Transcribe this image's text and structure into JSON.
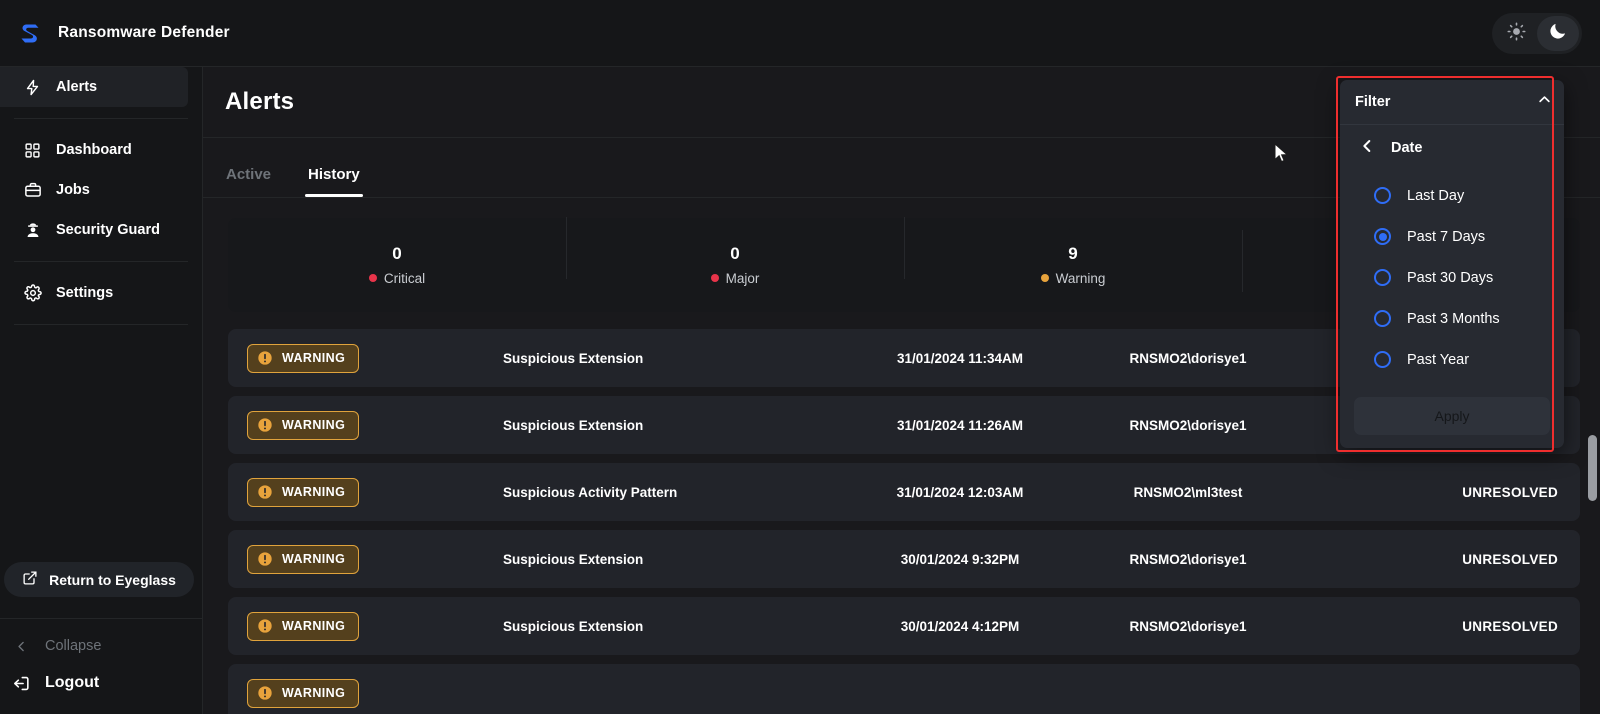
{
  "app": {
    "brand_title": "Ransomware Defender",
    "logo_icon": "shield-s-logo",
    "accent_color": "#2f6df6"
  },
  "theme_toggle": {
    "light_icon": "sun-icon",
    "dark_icon": "moon-icon",
    "active": "dark"
  },
  "sidebar": {
    "primary": [
      {
        "label": "Alerts",
        "icon": "lightning-bolt-icon",
        "active": true
      }
    ],
    "secondary": [
      {
        "label": "Dashboard",
        "icon": "grid-icon",
        "active": false
      },
      {
        "label": "Jobs",
        "icon": "briefcase-icon",
        "active": false
      },
      {
        "label": "Security Guard",
        "icon": "security-guard-icon",
        "active": false
      }
    ],
    "tertiary": [
      {
        "label": "Settings",
        "icon": "gear-icon",
        "active": false
      }
    ],
    "return_button": {
      "label": "Return to Eyeglass",
      "icon": "external-link-icon"
    },
    "collapse": {
      "label": "Collapse",
      "icon": "chevron-left-icon"
    },
    "logout": {
      "label": "Logout",
      "icon": "logout-icon"
    }
  },
  "main": {
    "page_title": "Alerts",
    "tabs": [
      {
        "label": "Active",
        "active": false
      },
      {
        "label": "History",
        "active": true
      }
    ],
    "stats": [
      {
        "value": "0",
        "label": "Critical",
        "color": "#e8344a"
      },
      {
        "value": "0",
        "label": "Major",
        "color": "#e8344a"
      },
      {
        "value": "9",
        "label": "Warning",
        "color": "#e8a33c"
      },
      {
        "value": "",
        "label": "",
        "color": "#2f6df6"
      }
    ],
    "alerts": [
      {
        "severity": "WARNING",
        "severity_icon": "warning-circle-icon",
        "name": "Suspicious Extension",
        "time": "31/01/2024 11:34AM",
        "user": "RNSMO2\\dorisye1",
        "status": ""
      },
      {
        "severity": "WARNING",
        "severity_icon": "warning-circle-icon",
        "name": "Suspicious Extension",
        "time": "31/01/2024 11:26AM",
        "user": "RNSMO2\\dorisye1",
        "status": ""
      },
      {
        "severity": "WARNING",
        "severity_icon": "warning-circle-icon",
        "name": "Suspicious Activity Pattern",
        "time": "31/01/2024 12:03AM",
        "user": "RNSMO2\\ml3test",
        "status": "UNRESOLVED"
      },
      {
        "severity": "WARNING",
        "severity_icon": "warning-circle-icon",
        "name": "Suspicious Extension",
        "time": "30/01/2024 9:32PM",
        "user": "RNSMO2\\dorisye1",
        "status": "UNRESOLVED"
      },
      {
        "severity": "WARNING",
        "severity_icon": "warning-circle-icon",
        "name": "Suspicious Extension",
        "time": "30/01/2024 4:12PM",
        "user": "RNSMO2\\dorisye1",
        "status": "UNRESOLVED"
      },
      {
        "severity": "WARNING",
        "severity_icon": "warning-circle-icon",
        "name": "",
        "time": "",
        "user": "",
        "status": ""
      }
    ]
  },
  "filter_panel": {
    "title": "Filter",
    "collapse_icon": "chevron-up-icon",
    "back_icon": "chevron-left-icon",
    "section_label": "Date",
    "options": [
      {
        "label": "Last Day",
        "selected": false
      },
      {
        "label": "Past 7 Days",
        "selected": true
      },
      {
        "label": "Past 30 Days",
        "selected": false
      },
      {
        "label": "Past 3 Months",
        "selected": false
      },
      {
        "label": "Past Year",
        "selected": false
      }
    ],
    "apply_label": "Apply",
    "highlight_color": "#ef2e2e"
  },
  "cursor": {
    "icon": "mouse-pointer-icon"
  }
}
